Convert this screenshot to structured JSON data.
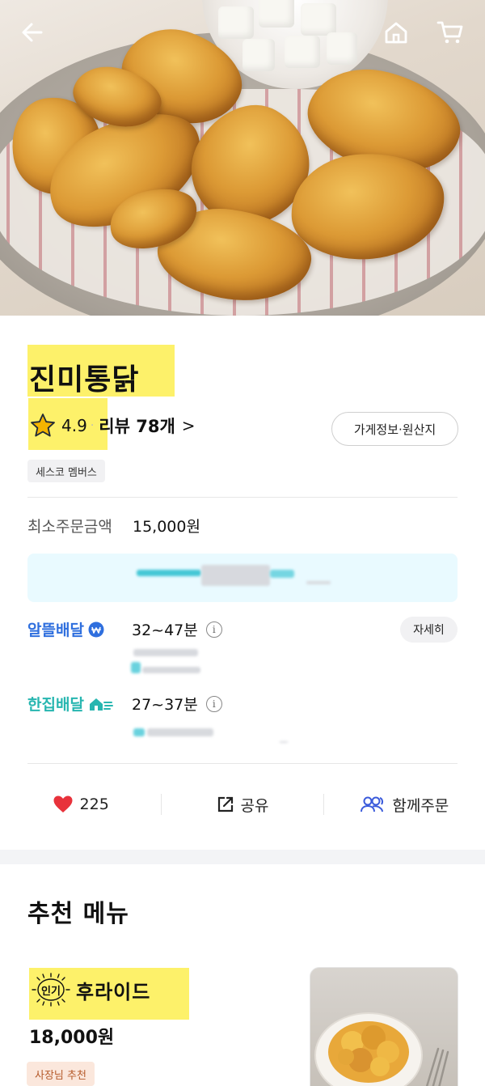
{
  "store": {
    "name": "진미통닭",
    "rating": "4.9",
    "rating_sep": "·",
    "reviews": "리뷰 78개",
    "review_arrow": ">",
    "info_button": "가게정보·원산지",
    "badge": "세스코 멤버스"
  },
  "min_order": {
    "label": "최소주문금액",
    "value": "15,000원"
  },
  "delivery": [
    {
      "name": "알뜰배달",
      "time": "32~47분",
      "color": "#2f6fde",
      "icon": "coin-won-icon"
    },
    {
      "name": "한집배달",
      "time": "27~37분",
      "color": "#27b6b0",
      "icon": "home-speed-icon"
    }
  ],
  "detail_button": "자세히",
  "actions": {
    "likes": "225",
    "share": "공유",
    "group_order": "함께주문"
  },
  "recommend": {
    "title": "추천 메뉴",
    "item": {
      "badge": "인기",
      "name": "후라이드",
      "price": "18,000원",
      "tag": "사장님 추천"
    }
  },
  "colors": {
    "highlight": "#fdf16a",
    "heart": "#e8323b",
    "group_icon": "#3b5bdb"
  }
}
